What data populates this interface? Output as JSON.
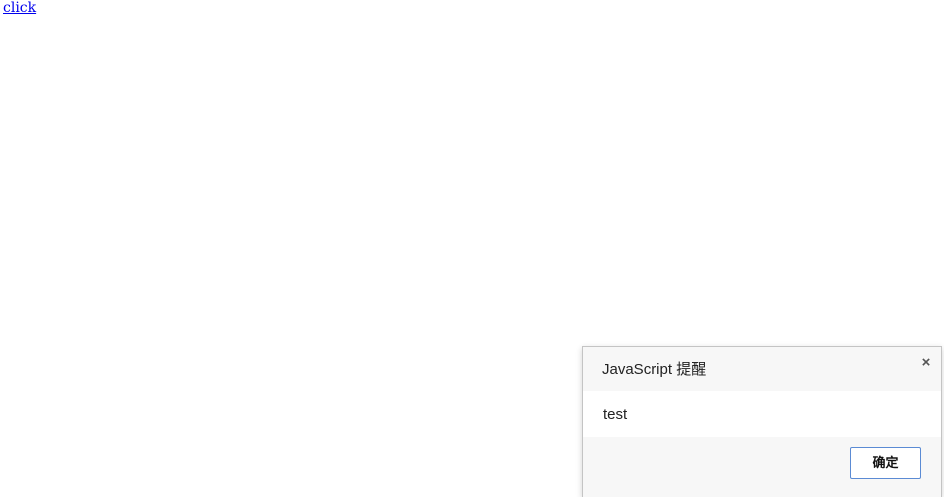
{
  "page": {
    "link_label": "click"
  },
  "dialog": {
    "title": "JavaScript 提醒",
    "message": "test",
    "close_glyph": "×",
    "ok_label": "确定"
  },
  "colors": {
    "link": "#0000ee",
    "button_border": "#5b8bd4",
    "dialog_bg": "#f7f7f7"
  },
  "icons": {
    "close": "close-icon"
  }
}
